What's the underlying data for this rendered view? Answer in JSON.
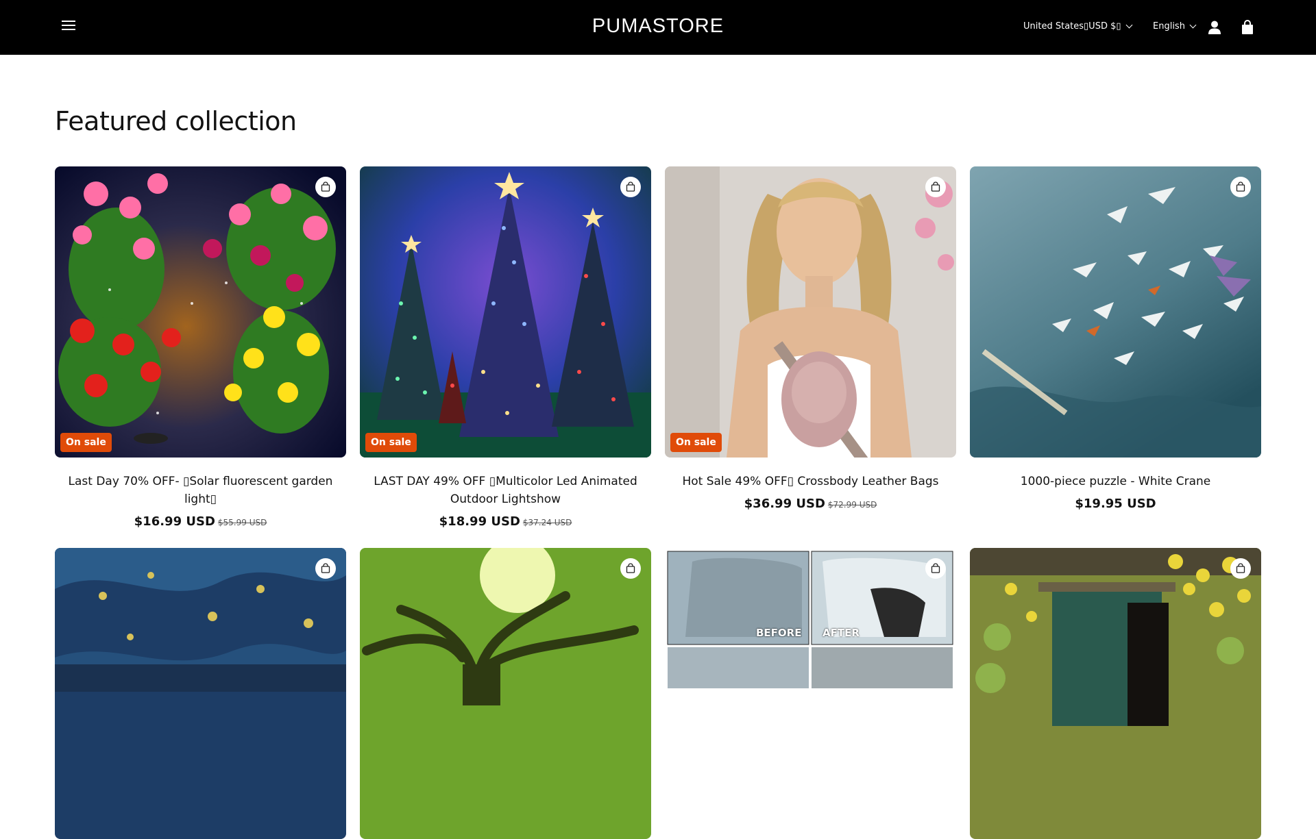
{
  "header": {
    "logo": "PUMASTORE",
    "country_selector": "United States\u0000USD $\u0000",
    "country_display": "United States▯USD $▯",
    "language": "English",
    "icons": [
      "menu-icon",
      "account-icon",
      "cart-icon"
    ]
  },
  "section": {
    "title": "Featured collection"
  },
  "products": [
    {
      "title": "Last Day 70% OFF- ▯Solar fluorescent garden light▯",
      "price": "$16.99 USD",
      "compare_price": "$55.99 USD",
      "badge": "On sale"
    },
    {
      "title": "LAST DAY 49% OFF ▯Multicolor Led Animated Outdoor Lightshow",
      "price": "$18.99 USD",
      "compare_price": "$37.24 USD",
      "badge": "On sale"
    },
    {
      "title": "Hot Sale 49% OFF▯ Crossbody Leather Bags",
      "price": "$36.99 USD",
      "compare_price": "$72.99 USD",
      "badge": "On sale"
    },
    {
      "title": "1000-piece puzzle - White Crane",
      "price": "$19.95 USD",
      "compare_price": "",
      "badge": ""
    }
  ],
  "second_row_images": {
    "rain_mirror_labels": [
      "BEFORE",
      "AFTER"
    ]
  },
  "colors": {
    "header_bg": "#000000",
    "sale_badge": "#e04b09"
  }
}
